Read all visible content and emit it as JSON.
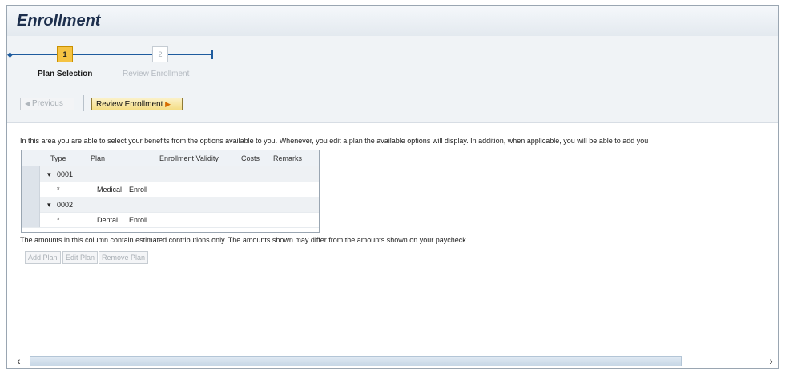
{
  "title": "Enrollment",
  "roadmap": {
    "steps": [
      {
        "number": "1",
        "label": "Plan Selection",
        "active": true
      },
      {
        "number": "2",
        "label": "Review Enrollment",
        "active": false
      }
    ],
    "accent_color": "#1e5b9e"
  },
  "toolbar": {
    "previous_label": "Previous",
    "review_label": "Review Enrollment"
  },
  "intro_text": "In this area you are able to select your benefits from the options available to you. Whenever, you edit a plan the available options will display. In addition, when applicable, you will be able to add you",
  "table": {
    "columns": [
      "Type",
      "Plan",
      "Enrollment Validity",
      "Costs",
      "Remarks"
    ],
    "rows": [
      {
        "kind": "group",
        "type": "0001"
      },
      {
        "kind": "item",
        "type": "*",
        "plan": "Medical",
        "validity": "Enroll"
      },
      {
        "kind": "group",
        "type": "0002"
      },
      {
        "kind": "item",
        "type": "*",
        "plan": "Dental",
        "validity": "Enroll"
      }
    ]
  },
  "note_text": "The amounts in this column contain estimated contributions only. The amounts shown may differ from the amounts shown on your paycheck.",
  "actions": {
    "add_label": "Add Plan",
    "edit_label": "Edit Plan",
    "remove_label": "Remove Plan"
  }
}
